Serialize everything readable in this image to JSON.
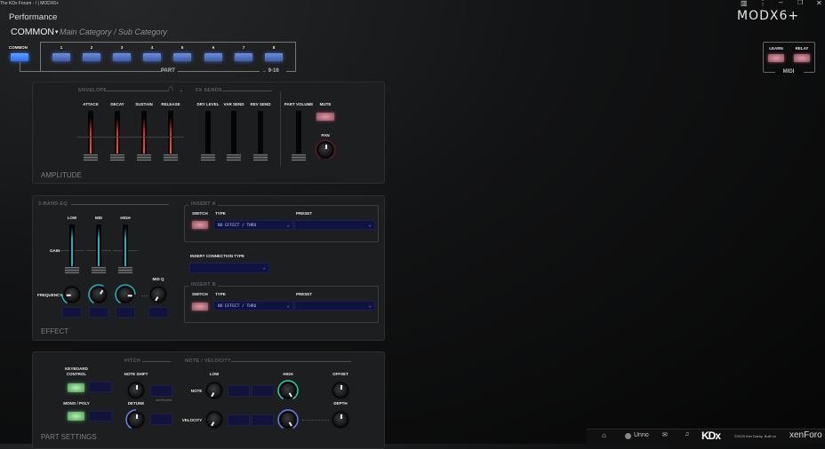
{
  "window": {
    "title": "The KDx Forum - / | MODX6+",
    "logo": "MODX6+",
    "icons": [
      "keyboard-icon",
      "more-icon",
      "minimize-icon",
      "restore-icon",
      "close-icon"
    ]
  },
  "header": {
    "mode": "Performance",
    "category": "COMMON",
    "category_caret": "▾",
    "subcategory": "Main Category / Sub Category"
  },
  "parts": {
    "common_label": "COMMON",
    "labels": [
      "1",
      "2",
      "3",
      "4",
      "5",
      "6",
      "7",
      "8"
    ],
    "group_label": "PART",
    "more_label": "→ 9-16"
  },
  "midi": {
    "learn": "LEARN",
    "relay": "RELAY",
    "group_label": "MIDI"
  },
  "amplitude": {
    "title": "AMPLITUDE",
    "envelope": "ENVELOPE",
    "fx_sends": "FX SENDS",
    "sliders": [
      "ATTACK",
      "DECAY",
      "SUSTAIN",
      "RELEASE",
      "DRY LEVEL",
      "VAR SEND",
      "REV SEND",
      "PART VOLUME"
    ],
    "mute": "MUTE",
    "pan": "PAN"
  },
  "effect": {
    "title": "EFFECT",
    "eq_title": "3-BAND EQ",
    "bands": [
      "LOW",
      "MID",
      "HIGH"
    ],
    "gain": "GAIN",
    "frequency": "FREQUENCY",
    "mid_q": "MID Q",
    "insert_a": {
      "title": "INSERT A",
      "switch": "SWITCH",
      "type": "TYPE",
      "preset": "PRESET",
      "type_value": "NO EFFECT / THRU"
    },
    "connection_label": "INSERT CONNECTION TYPE",
    "insert_b": {
      "title": "INSERT B",
      "switch": "SWITCH",
      "type": "TYPE",
      "preset": "PRESET",
      "type_value": "NO EFFECT / THRU"
    }
  },
  "part_settings": {
    "title": "PART SETTINGS",
    "pitch": "PITCH",
    "note_velocity": "NOTE / VELOCITY",
    "keyboard_control": [
      "KEYBOARD",
      "CONTROL"
    ],
    "mono_poly": "MONO / POLY",
    "note_shift": "NOTE SHIFT",
    "semitones": "semitones",
    "detune": "DETUNE",
    "low": "LOW",
    "high": "HIGH",
    "note": "NOTE",
    "velocity": "VELOCITY",
    "offset": "OFFSET",
    "depth": "DEPTH"
  },
  "footer": {
    "user": "Unno",
    "brand": "KDx",
    "copyright": "©2025 Kier Darby. Built on",
    "platform": "xenForo"
  },
  "colors": {
    "accent_blue": "#4d6fd0",
    "envelope_red": "#e0262c",
    "eq_teal": "#1fb3c0",
    "green_arc": "#2ecf9a",
    "blue_arc": "#6a7cf0"
  }
}
